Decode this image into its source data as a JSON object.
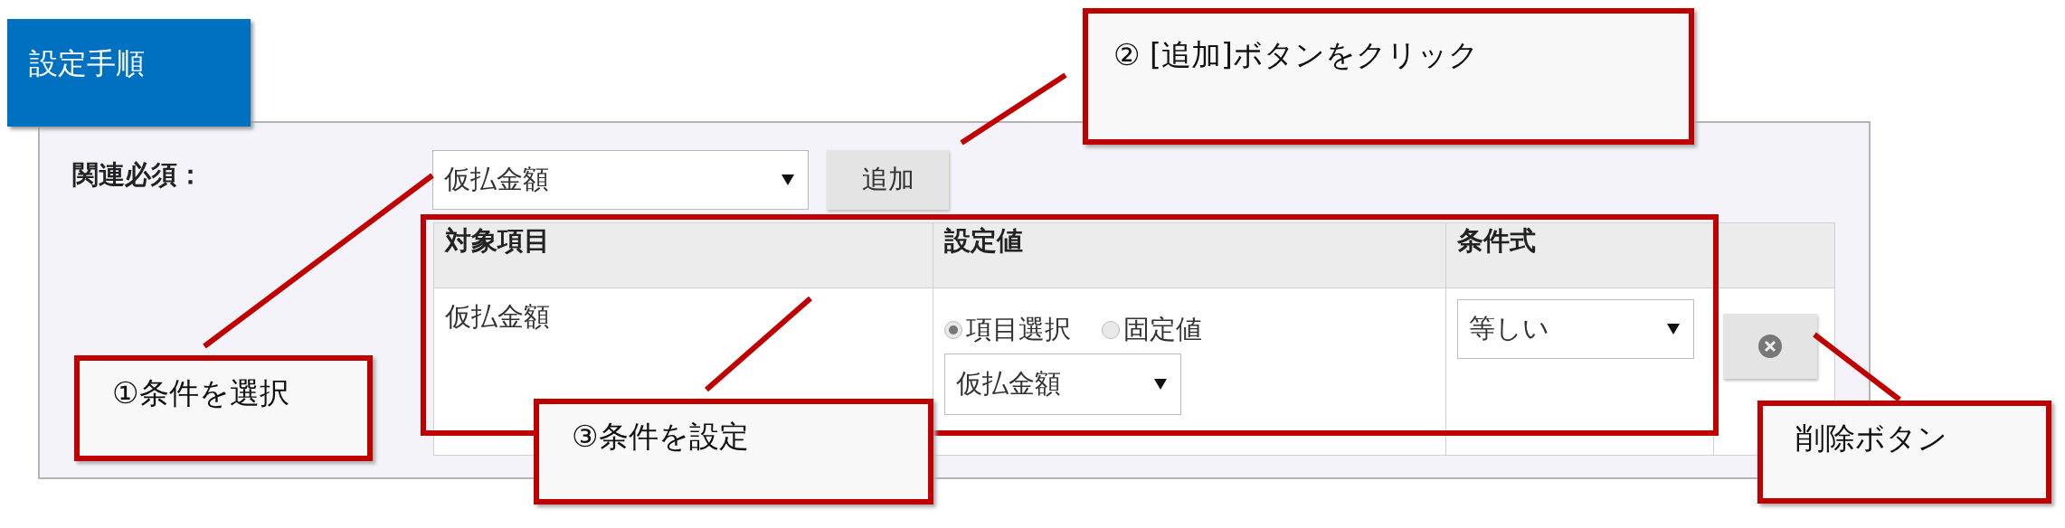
{
  "heading": "設定手順",
  "form": {
    "label": "関連必須：",
    "select_value": "仮払金額",
    "add_button": "追加",
    "table": {
      "columns": [
        "対象項目",
        "設定値",
        "条件式"
      ],
      "rows": [
        {
          "target": "仮払金額",
          "options": [
            {
              "label": "項目選択",
              "selected": true
            },
            {
              "label": "固定値",
              "selected": false
            }
          ],
          "value_select": "仮払金額",
          "condition": "等しい"
        }
      ]
    }
  },
  "callouts": [
    {
      "text": "② [追加]ボタンをクリック"
    },
    {
      "text": "①条件を選択"
    },
    {
      "text": "③条件を設定"
    },
    {
      "text": "削除ボタン"
    }
  ]
}
